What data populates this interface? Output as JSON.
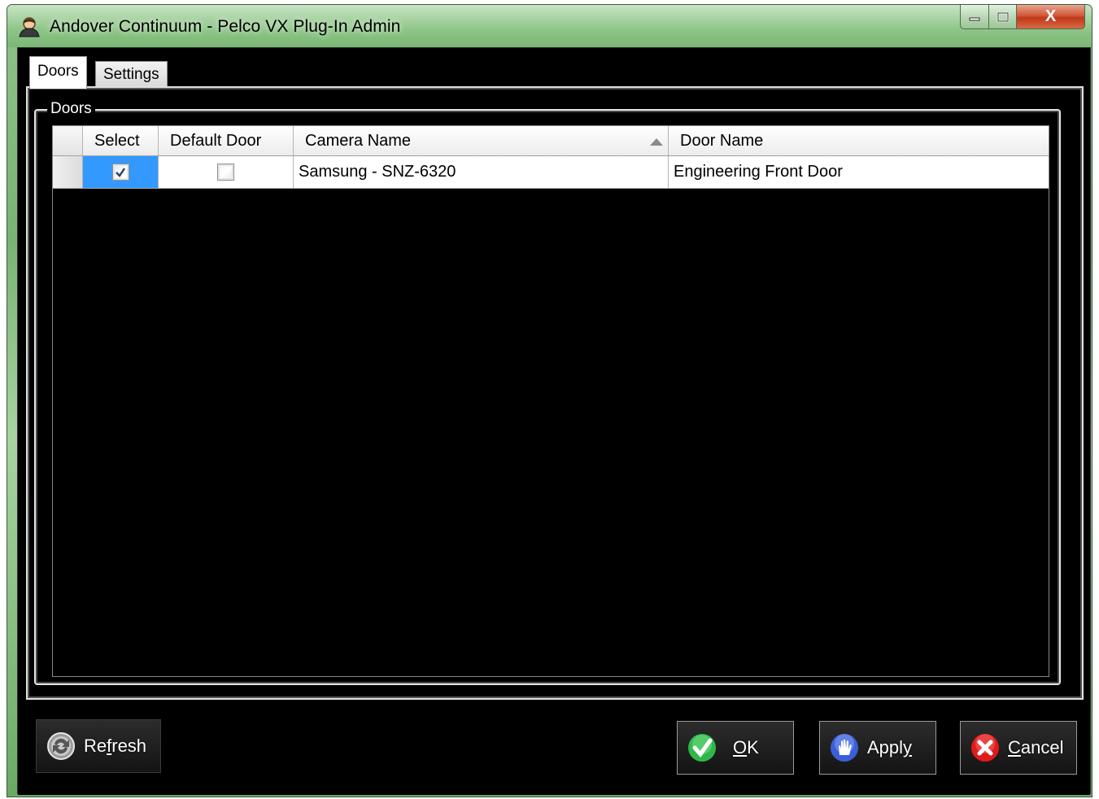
{
  "window": {
    "title": "Andover Continuum - Pelco VX Plug-In Admin",
    "close_glyph": "X"
  },
  "tabs": [
    {
      "label": "Doors",
      "active": true
    },
    {
      "label": "Settings",
      "active": false
    }
  ],
  "group": {
    "legend": "Doors"
  },
  "grid": {
    "columns": [
      "Select",
      "Default Door",
      "Camera Name",
      "Door Name"
    ],
    "sort_column": "Camera Name",
    "sort_direction": "ascending",
    "rows": [
      {
        "select": true,
        "default_door": false,
        "camera_name": "Samsung - SNZ-6320",
        "door_name": "Engineering Front Door"
      }
    ]
  },
  "buttons": {
    "refresh": {
      "label_pre": "Re",
      "label_ul": "f",
      "label_post": "resh",
      "icon": "refresh-icon"
    },
    "ok": {
      "label_pre": "",
      "label_ul": "O",
      "label_post": "K",
      "icon": "checkmark-icon"
    },
    "apply": {
      "label_pre": "Appl",
      "label_ul": "y",
      "label_post": "",
      "icon": "hand-icon"
    },
    "cancel": {
      "label_pre": "",
      "label_ul": "C",
      "label_post": "ancel",
      "icon": "x-icon"
    }
  },
  "colors": {
    "selection": "#3399ff",
    "ok_icon": "#2fb84a",
    "apply_icon": "#3a5fd8",
    "cancel_icon": "#e01b1b"
  }
}
